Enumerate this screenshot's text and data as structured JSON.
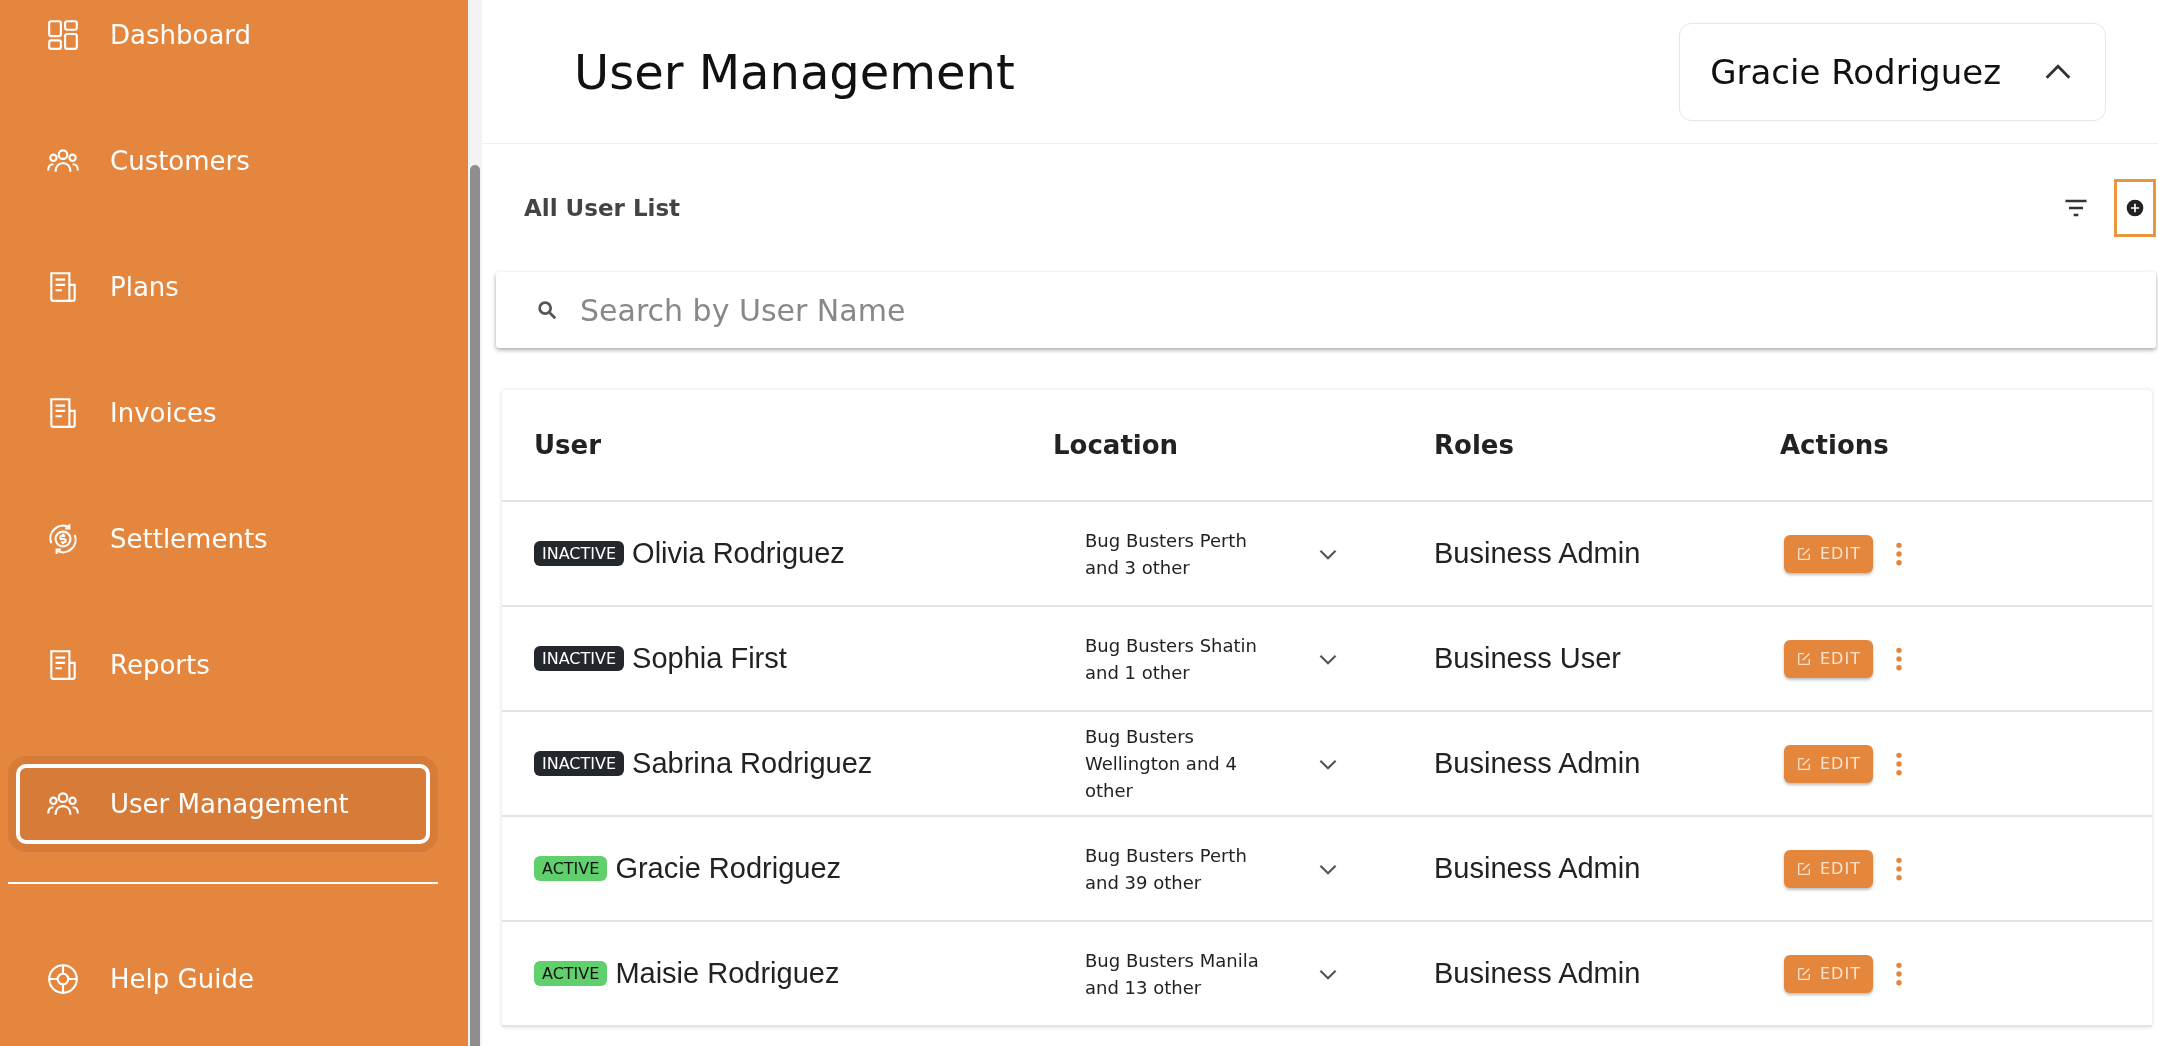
{
  "sidebar": {
    "items": [
      {
        "label": "Dashboard",
        "kind": "grid",
        "selected": false
      },
      {
        "label": "Customers",
        "kind": "people",
        "selected": false
      },
      {
        "label": "Plans",
        "kind": "doc",
        "selected": false
      },
      {
        "label": "Invoices",
        "kind": "doc",
        "selected": false
      },
      {
        "label": "Settlements",
        "kind": "money",
        "selected": false
      },
      {
        "label": "Reports",
        "kind": "doc",
        "selected": false
      },
      {
        "label": "User Management",
        "kind": "people",
        "selected": true
      }
    ],
    "footer_items": [
      {
        "label": "Help Guide",
        "kind": "lifebuoy",
        "selected": false
      }
    ]
  },
  "header": {
    "title": "User Management",
    "profile": {
      "name": "Gracie Rodriguez",
      "expanded": true
    }
  },
  "list": {
    "title": "All User List",
    "search": {
      "placeholder": "Search by User Name"
    },
    "table": {
      "columns": [
        "User",
        "Location",
        "Roles",
        "Actions"
      ],
      "rows": [
        {
          "status": {
            "label": "INACTIVE",
            "active": false
          },
          "user": "Olivia Rodriguez",
          "location": "Bug Busters Perth and 3 other",
          "role": "Business Admin",
          "action": "EDIT"
        },
        {
          "status": {
            "label": "INACTIVE",
            "active": false
          },
          "user": "Sophia First",
          "location": "Bug Busters Shatin and 1 other",
          "role": "Business User",
          "action": "EDIT"
        },
        {
          "status": {
            "label": "INACTIVE",
            "active": false
          },
          "user": "Sabrina Rodriguez",
          "location": "Bug Busters Wellington and 4 other",
          "role": "Business Admin",
          "action": "EDIT"
        },
        {
          "status": {
            "label": "ACTIVE",
            "active": true
          },
          "user": "Gracie Rodriguez",
          "location": "Bug Busters Perth and 39 other",
          "role": "Business Admin",
          "action": "EDIT"
        },
        {
          "status": {
            "label": "ACTIVE",
            "active": true
          },
          "user": "Maisie Rodriguez",
          "location": "Bug Busters Manila and 13 other",
          "role": "Business Admin",
          "action": "EDIT"
        }
      ]
    }
  }
}
